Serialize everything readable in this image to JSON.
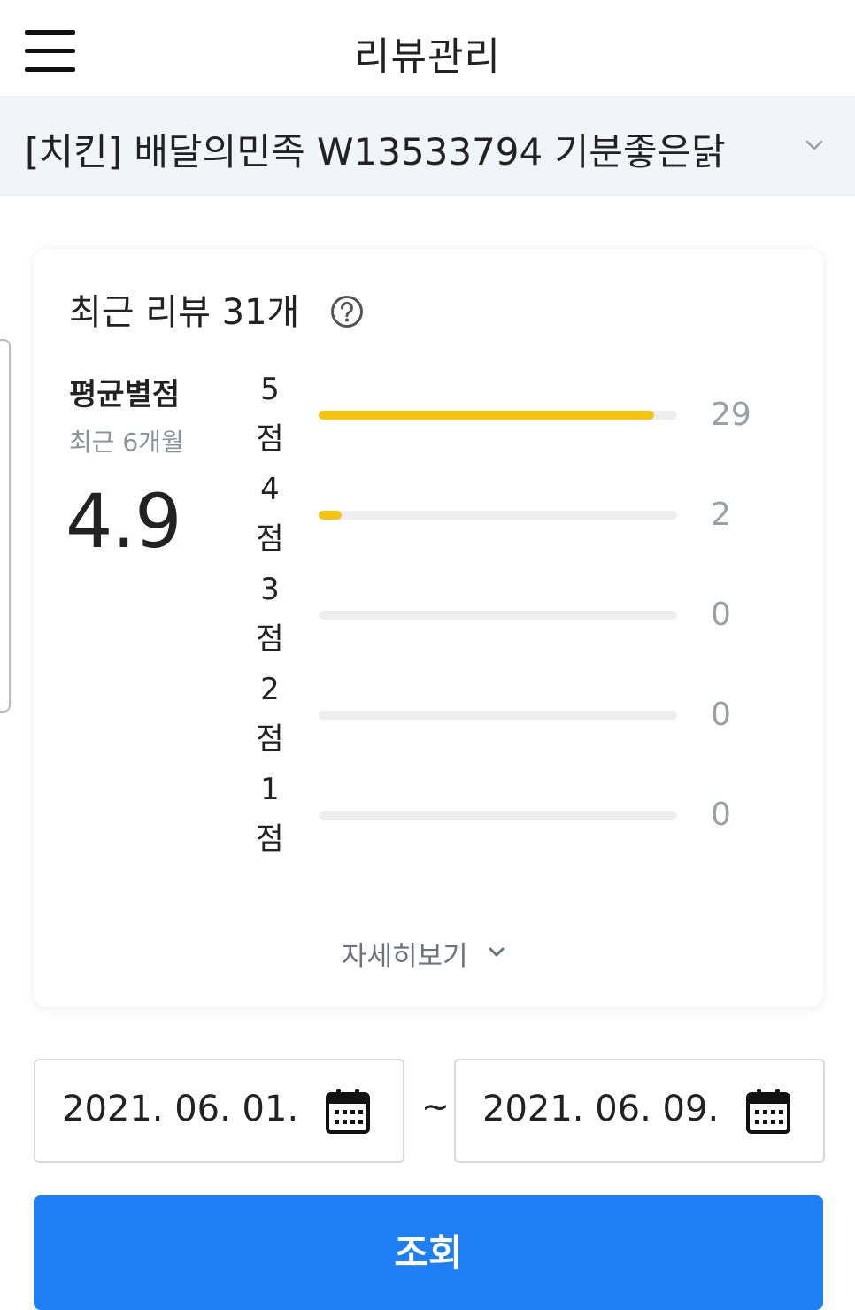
{
  "header": {
    "title": "리뷰관리",
    "menu_icon": "hamburger-icon"
  },
  "store_selector": {
    "value": "[치킨] 배달의민족 W13533794 기분좋은닭",
    "icon": "chevron-down-icon"
  },
  "review_summary": {
    "title": "최근 리뷰 31개",
    "help_icon": "question-circle-icon",
    "average_label": "평균별점",
    "average_sub": "최근 6개월",
    "average_value": "4.9",
    "detail_label": "자세히보기",
    "rows": [
      {
        "score": "5",
        "unit": "점",
        "count": "29",
        "fraction": 0.935
      },
      {
        "score": "4",
        "unit": "점",
        "count": "2",
        "fraction": 0.065
      },
      {
        "score": "3",
        "unit": "점",
        "count": "0",
        "fraction": 0
      },
      {
        "score": "2",
        "unit": "점",
        "count": "0",
        "fraction": 0
      },
      {
        "score": "1",
        "unit": "점",
        "count": "0",
        "fraction": 0
      }
    ],
    "bar_color": "#f6c40f"
  },
  "date_range": {
    "start": "2021. 06. 01.",
    "end": "2021. 06. 09.",
    "separator": "~",
    "calendar_icon": "calendar-icon"
  },
  "search_button": {
    "label": "조회",
    "color": "#1e7ff5"
  }
}
